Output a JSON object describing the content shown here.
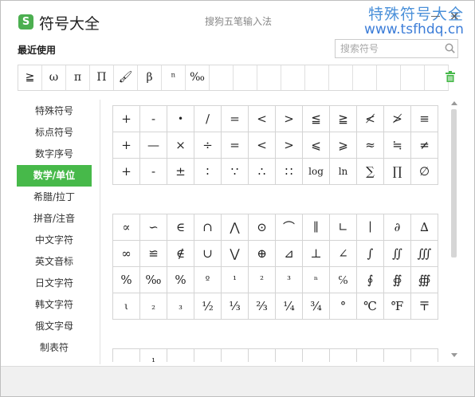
{
  "app": {
    "logo_glyph": "S",
    "title": "符号大全",
    "ime_title": "搜狗五笔输入法",
    "watermark_cn": "特殊符号大全",
    "watermark_url": "www.tsfhdq.cn",
    "close_glyph": "×",
    "accent_color": "#47b94a"
  },
  "recent": {
    "label": "最近使用",
    "items": [
      "≧",
      "ω",
      "π",
      "Π",
      "🖌",
      "β",
      "ⁿ",
      "‰",
      "",
      "",
      "",
      "",
      "",
      "",
      "",
      "",
      "",
      ""
    ]
  },
  "search": {
    "placeholder": "搜索符号",
    "value": ""
  },
  "sidebar": {
    "items": [
      {
        "label": "特殊符号"
      },
      {
        "label": "标点符号"
      },
      {
        "label": "数字序号"
      },
      {
        "label": "数学/单位",
        "active": true
      },
      {
        "label": "希腊/拉丁"
      },
      {
        "label": "拼音/注音"
      },
      {
        "label": "中文字符"
      },
      {
        "label": "英文音标"
      },
      {
        "label": "日文字符"
      },
      {
        "label": "韩文字符"
      },
      {
        "label": "俄文字母"
      },
      {
        "label": "制表符"
      }
    ]
  },
  "symbols": {
    "group1": [
      "+",
      "-",
      "•",
      "∕",
      "=",
      "<",
      ">",
      "≦",
      "≧",
      "≮",
      "≯",
      "≡",
      "+",
      "—",
      "×",
      "÷",
      "=",
      "<",
      ">",
      "⩽",
      "⩾",
      "≈",
      "≒",
      "≠",
      "+",
      "-",
      "±",
      "∶",
      "∵",
      "∴",
      "∷",
      "log",
      "ln",
      "∑",
      "∏",
      "∅"
    ],
    "group2": [
      "∝",
      "∽",
      "∈",
      "∩",
      "⋀",
      "⊙",
      "⌒",
      "∥",
      "∟",
      "∣",
      "∂",
      "∆",
      "∞",
      "≌",
      "∉",
      "∪",
      "⋁",
      "⊕",
      "⊿",
      "⊥",
      "∠",
      "∫",
      "∬",
      "∭",
      "%",
      "‰",
      "%",
      "º",
      "¹",
      "²",
      "³",
      "ⁿ",
      "℅",
      "∮",
      "∯",
      "∰",
      "ι",
      "₂",
      "₃",
      "½",
      "⅓",
      "⅔",
      "¼",
      "¾",
      "°",
      "℃",
      "℉",
      "〒"
    ],
    "group3": [
      "",
      "¹",
      "",
      "",
      "",
      "",
      "",
      "",
      "",
      "",
      "",
      ""
    ]
  }
}
